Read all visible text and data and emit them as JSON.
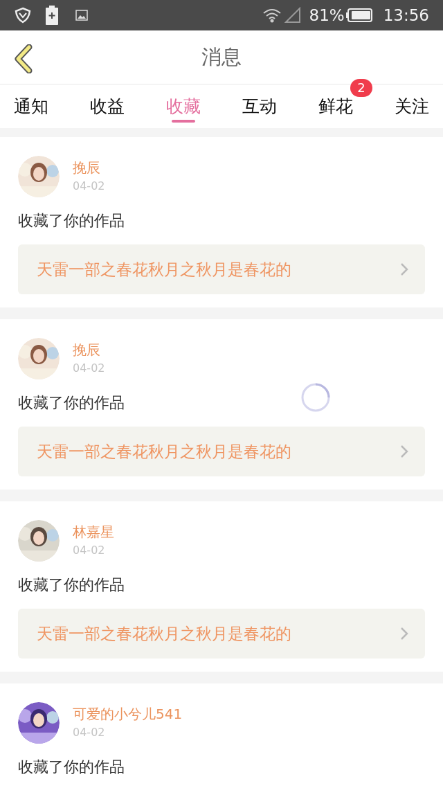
{
  "status_bar": {
    "battery": "81%",
    "time": "13:56"
  },
  "header": {
    "title": "消息"
  },
  "tabs": [
    {
      "label": "通知",
      "selected": false
    },
    {
      "label": "收益",
      "selected": false
    },
    {
      "label": "收藏",
      "selected": true
    },
    {
      "label": "互动",
      "selected": false
    },
    {
      "label": "鲜花",
      "selected": false,
      "badge": "2"
    },
    {
      "label": "关注",
      "selected": false
    }
  ],
  "messages": [
    {
      "name": "挽辰",
      "date": "04-02",
      "action": "收藏了你的作品",
      "work": "天雷一部之春花秋月之秋月是春花的"
    },
    {
      "name": "挽辰",
      "date": "04-02",
      "action": "收藏了你的作品",
      "work": "天雷一部之春花秋月之秋月是春花的"
    },
    {
      "name": "林嘉星",
      "date": "04-02",
      "action": "收藏了你的作品",
      "work": "天雷一部之春花秋月之秋月是春花的"
    },
    {
      "name": "可爱的小兮儿541",
      "date": "04-02",
      "action": "收藏了你的作品"
    }
  ]
}
